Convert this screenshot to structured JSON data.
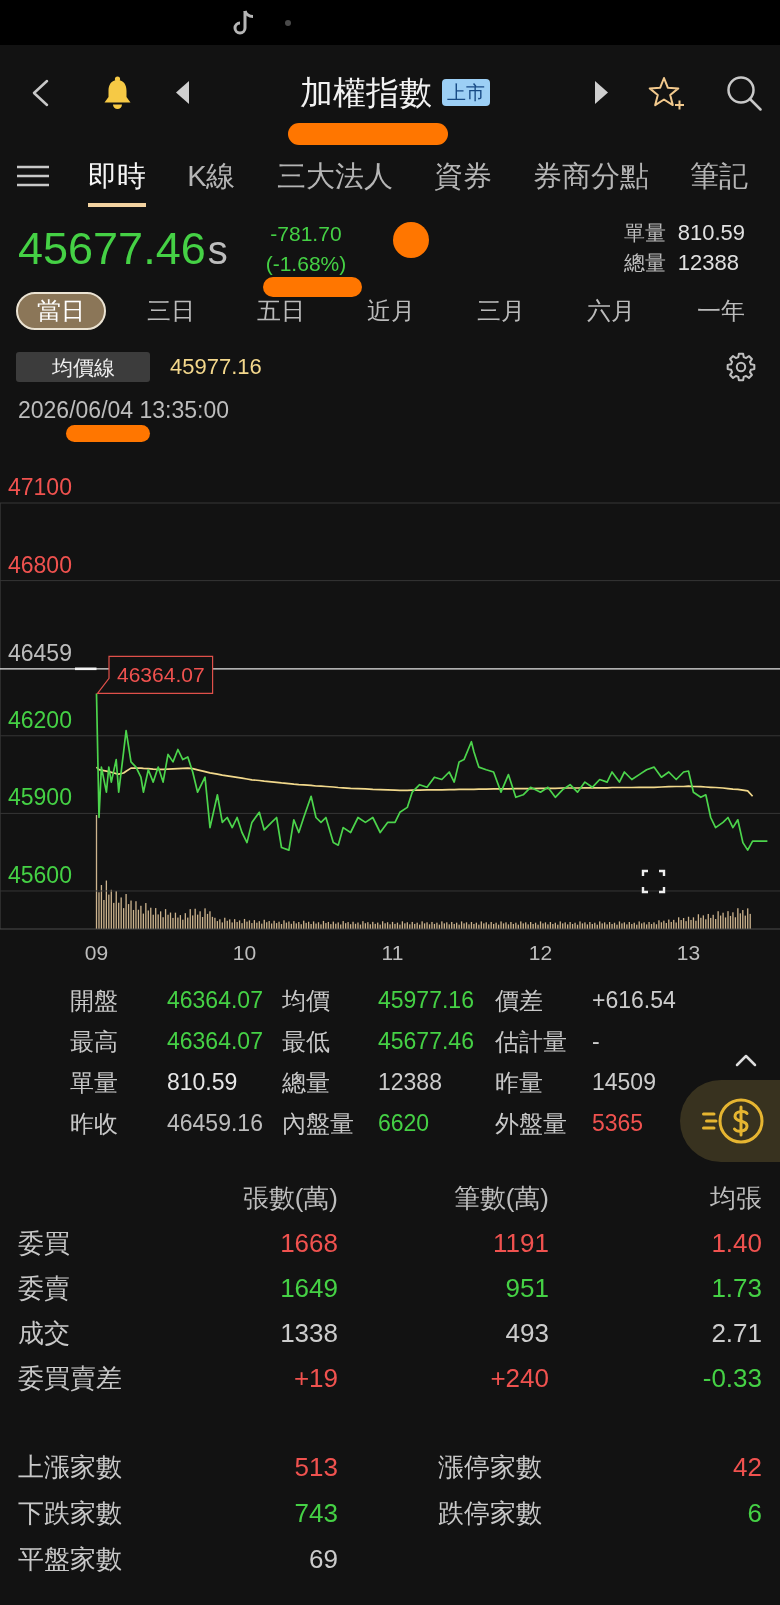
{
  "header": {
    "title": "加權指數",
    "badge": "上市"
  },
  "nav_tabs": [
    {
      "label": "即時",
      "selected": true
    },
    {
      "label": "K線",
      "selected": false
    },
    {
      "label": "三大法人",
      "selected": false
    },
    {
      "label": "資券",
      "selected": false
    },
    {
      "label": "券商分點",
      "selected": false
    },
    {
      "label": "筆記",
      "selected": false
    }
  ],
  "quote": {
    "price": "45677.46",
    "suffix": "s",
    "color": "#45d145",
    "change": "-781.70",
    "change_percent": "(-1.68%)",
    "volumes": [
      {
        "label": "單量",
        "value": "810.59"
      },
      {
        "label": "總量",
        "value": "12388"
      }
    ]
  },
  "range_tabs": [
    {
      "label": "當日",
      "selected": true
    },
    {
      "label": "三日",
      "selected": false
    },
    {
      "label": "五日",
      "selected": false
    },
    {
      "label": "近月",
      "selected": false
    },
    {
      "label": "三月",
      "selected": false
    },
    {
      "label": "六月",
      "selected": false
    },
    {
      "label": "一年",
      "selected": false
    }
  ],
  "average_line": {
    "label": "均價線",
    "value": "45977.16"
  },
  "timestamp": "2026/06/04 13:35:00",
  "chart": {
    "chart_data": {
      "type": "line",
      "grid": true,
      "x": [
        9,
        9.017,
        9.033,
        9.067,
        9.083,
        9.1,
        9.133,
        9.15,
        9.183,
        9.2,
        9.233,
        9.267,
        9.3,
        9.317,
        9.35,
        9.383,
        9.417,
        9.45,
        9.483,
        9.517,
        9.55,
        9.583,
        9.617,
        9.65,
        9.683,
        9.733,
        9.767,
        9.817,
        9.85,
        9.883,
        9.917,
        9.95,
        9.983,
        10.017,
        10.05,
        10.1,
        10.133,
        10.183,
        10.217,
        10.25,
        10.3,
        10.333,
        10.367,
        10.4,
        10.45,
        10.483,
        10.517,
        10.55,
        10.6,
        10.633,
        10.667,
        10.717,
        10.767,
        10.817,
        10.867,
        10.917,
        10.967,
        11.017,
        11.05,
        11.1,
        11.133,
        11.183,
        11.233,
        11.283,
        11.333,
        11.383,
        11.417,
        11.45,
        11.483,
        11.533,
        11.55,
        11.583,
        11.633,
        11.683,
        11.733,
        11.783,
        11.833,
        11.883,
        11.933,
        12,
        12.05,
        12.1,
        12.15,
        12.2,
        12.25,
        12.3,
        12.35,
        12.4,
        12.45,
        12.483,
        12.533,
        12.567,
        12.617,
        12.667,
        12.717,
        12.767,
        12.817,
        12.867,
        12.917,
        12.967,
        13,
        13.033,
        13.083,
        13.117,
        13.15,
        13.183,
        13.233,
        13.267,
        13.3,
        13.333,
        13.367,
        13.4,
        13.433,
        13.533
      ],
      "series": [
        {
          "color": "#4cd44c",
          "values": [
            46364,
            45884,
            46079,
            45982,
            46079,
            46021,
            46108,
            45982,
            46138,
            46220,
            46099,
            46079,
            46040,
            45982,
            46069,
            46021,
            46079,
            46021,
            46128,
            46099,
            46147,
            46108,
            46118,
            46060,
            45982,
            46040,
            45845,
            45972,
            45865,
            45884,
            45845,
            45884,
            45826,
            45787,
            45865,
            45904,
            45836,
            45865,
            45884,
            45768,
            45758,
            45875,
            45826,
            45884,
            45966,
            45884,
            45865,
            45884,
            45787,
            45777,
            45845,
            45826,
            45884,
            45865,
            45884,
            45826,
            45865,
            45865,
            45904,
            45923,
            45982,
            46011,
            46001,
            46040,
            46031,
            46060,
            46021,
            46099,
            46108,
            46177,
            46138,
            46079,
            46069,
            46060,
            45982,
            46050,
            45962,
            45972,
            46001,
            45982,
            46001,
            45962,
            45992,
            46011,
            45982,
            46021,
            46001,
            46031,
            46021,
            46060,
            46021,
            46060,
            46031,
            46050,
            46069,
            46079,
            46040,
            46060,
            46031,
            46060,
            46064,
            45982,
            45962,
            45972,
            45884,
            45845,
            45865,
            45884,
            45845,
            45875,
            45787,
            45758,
            45793,
            45793
          ]
        },
        {
          "color": "#f2d98c",
          "values": [
            46079,
            46069,
            46067,
            46063,
            46061,
            46059,
            46054,
            46052,
            46056,
            46063,
            46075,
            46075,
            46075,
            46074,
            46073,
            46071,
            46070,
            46070,
            46071,
            46072,
            46073,
            46074,
            46075,
            46073,
            46068,
            46061,
            46057,
            46052,
            46048,
            46045,
            46042,
            46039,
            46036,
            46033,
            46030,
            46027,
            46025,
            46022,
            46020,
            46018,
            46015,
            46013,
            46011,
            46010,
            46008,
            46006,
            46005,
            46004,
            46002,
            46000,
            45999,
            45997,
            45996,
            45995,
            45993,
            45992,
            45991,
            45990,
            45989,
            45989,
            45990,
            45990,
            45991,
            45991,
            45991,
            45992,
            45992,
            45993,
            45993,
            45993,
            45993,
            45994,
            45994,
            45995,
            45995,
            45995,
            45996,
            45996,
            45996,
            45997,
            45997,
            45997,
            45998,
            45998,
            45998,
            45999,
            45999,
            45999,
            45999,
            46000,
            46000,
            46000,
            46000,
            46001,
            46001,
            46001,
            46002,
            46003,
            46004,
            46004,
            46005,
            46004,
            46003,
            46002,
            46001,
            46000,
            45998,
            45996,
            45994,
            45993,
            45990,
            45987,
            45966,
            null
          ]
        }
      ],
      "xlim": [
        8.348,
        13.618
      ],
      "ylim": [
        45453,
        47100
      ],
      "xticks": [
        {
          "value": 9,
          "label": "09"
        },
        {
          "value": 10,
          "label": "10"
        },
        {
          "value": 11,
          "label": "11"
        },
        {
          "value": 12,
          "label": "12"
        },
        {
          "value": 13,
          "label": "13"
        }
      ],
      "yticks": [
        47100,
        46800,
        46459,
        46200,
        45900,
        45600
      ],
      "ref_lines": [
        {
          "axis": "y",
          "value": 46459
        }
      ],
      "annotations": [
        {
          "text": "46364.07",
          "x": 9,
          "y": 46364.07
        }
      ]
    }
  },
  "summary": [
    {
      "label": "開盤",
      "value": "46364.07",
      "color": "#45d145"
    },
    {
      "label": "均價",
      "value": "45977.16",
      "color": "#45d145"
    },
    {
      "label": "價差",
      "value": "+616.54",
      "color": "#cccccc"
    },
    {
      "label": "最高",
      "value": "46364.07",
      "color": "#45d145"
    },
    {
      "label": "最低",
      "value": "45677.46",
      "color": "#45d145"
    },
    {
      "label": "估計量",
      "value": "-",
      "color": "#cccccc"
    },
    {
      "label": "單量",
      "value": "810.59",
      "color": "#e6e6e6"
    },
    {
      "label": "總量",
      "value": "12388",
      "color": "#cccccc"
    },
    {
      "label": "昨量",
      "value": "14509",
      "color": "#cccccc"
    },
    {
      "label": "昨收",
      "value": "46459.16",
      "color": "#bdbdbd"
    },
    {
      "label": "內盤量",
      "value": "6620",
      "color": "#45d145"
    },
    {
      "label": "外盤量",
      "value": "5365",
      "color": "#f0524f"
    }
  ],
  "order_book": {
    "columns": [
      "張數(萬)",
      "筆數(萬)",
      "均張"
    ],
    "rows": [
      {
        "label": "委買",
        "cells": [
          {
            "value": "1668",
            "color": "#f0524f"
          },
          {
            "value": "1191",
            "color": "#f0524f"
          },
          {
            "value": "1.40",
            "color": "#f0524f"
          }
        ]
      },
      {
        "label": "委賣",
        "cells": [
          {
            "value": "1649",
            "color": "#45d145"
          },
          {
            "value": "951",
            "color": "#45d145"
          },
          {
            "value": "1.73",
            "color": "#45d145"
          }
        ]
      },
      {
        "label": "成交",
        "cells": [
          {
            "value": "1338",
            "color": "#cccccc"
          },
          {
            "value": "493",
            "color": "#cccccc"
          },
          {
            "value": "2.71",
            "color": "#cccccc"
          }
        ]
      },
      {
        "label": "委買賣差",
        "cells": [
          {
            "value": "+19",
            "color": "#f0524f"
          },
          {
            "value": "+240",
            "color": "#f0524f"
          },
          {
            "value": "-0.33",
            "color": "#45d145"
          }
        ]
      }
    ]
  },
  "breadth": {
    "left": [
      {
        "label": "上漲家數",
        "value": "513",
        "color": "#f0524f"
      },
      {
        "label": "下跌家數",
        "value": "743",
        "color": "#45d145"
      },
      {
        "label": "平盤家數",
        "value": "69",
        "color": "#cccccc"
      }
    ],
    "right": [
      {
        "label": "漲停家數",
        "value": "42",
        "color": "#f0524f"
      },
      {
        "label": "跌停家數",
        "value": "6",
        "color": "#45d145"
      }
    ]
  }
}
